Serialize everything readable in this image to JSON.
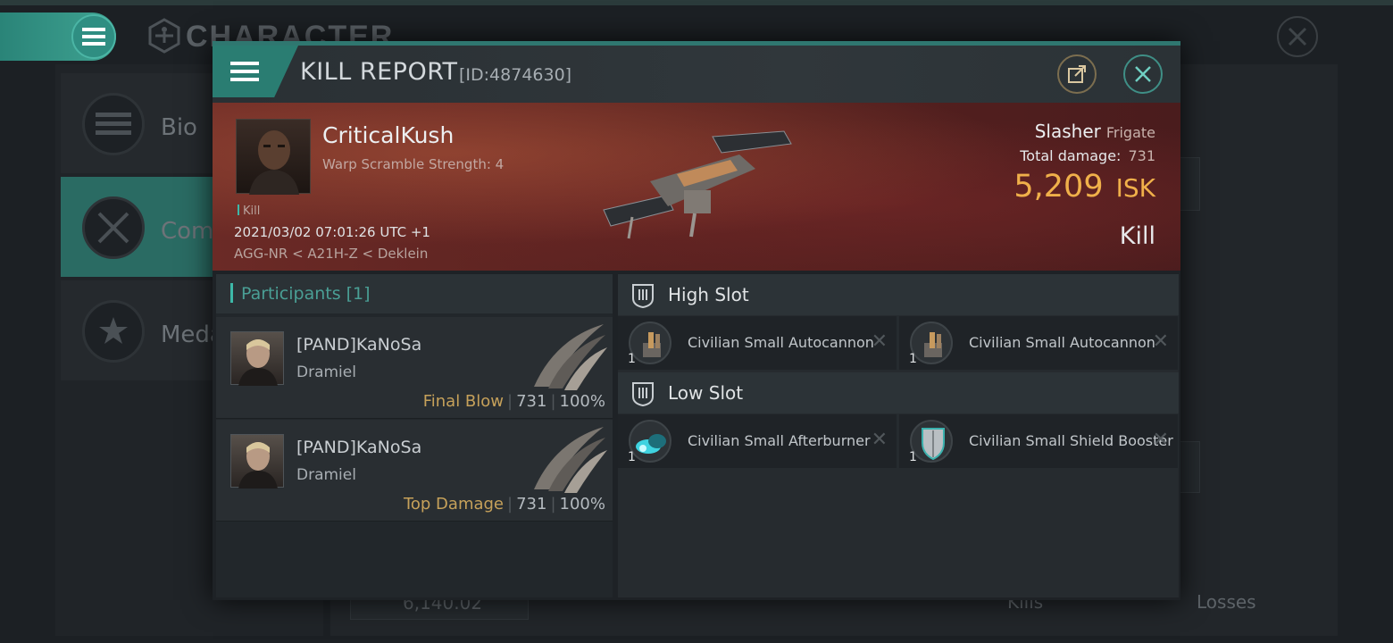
{
  "background": {
    "title": "CHARACTER",
    "sidebar": [
      {
        "label": "Bio",
        "icon": "menu-lines-icon"
      },
      {
        "label": "Comb",
        "icon": "crossed-swords-icon"
      },
      {
        "label": "Meda",
        "icon": "medal-star-icon"
      }
    ],
    "snippets": {
      "value": "6,140.02",
      "kills": "Kills",
      "losses": "Losses"
    }
  },
  "report": {
    "title": "KILL REPORT",
    "id": "[ID:4874630]",
    "victim": {
      "name": "CriticalKush",
      "warp": "Warp Scramble Strength: 4",
      "tag": "Kill",
      "datetime": "2021/03/02 07:01:26 UTC +1",
      "location": "AGG-NR < A21H-Z < Deklein"
    },
    "ship": {
      "name": "Slasher",
      "class": "Frigate",
      "damage_label": "Total damage:",
      "damage": "731",
      "isk_value": "5,209",
      "isk_unit": "ISK",
      "result": "Kill"
    },
    "participants_label": "Participants [1]",
    "participants": [
      {
        "name": "[PAND]KaNoSa",
        "ship": "Dramiel",
        "role": "Final Blow",
        "damage": "731",
        "percent": "100%"
      },
      {
        "name": "[PAND]KaNoSa",
        "ship": "Dramiel",
        "role": "Top Damage",
        "damage": "731",
        "percent": "100%"
      }
    ],
    "slots": [
      {
        "label": "High Slot",
        "modules": [
          {
            "name": "Civilian Small Autocannon",
            "qty": "1",
            "icon": "autocannon-icon"
          },
          {
            "name": "Civilian Small Autocannon",
            "qty": "1",
            "icon": "autocannon-icon"
          }
        ]
      },
      {
        "label": "Low Slot",
        "modules": [
          {
            "name": "Civilian Small Afterburner",
            "qty": "1",
            "icon": "afterburner-icon"
          },
          {
            "name": "Civilian Small Shield Booster",
            "qty": "1",
            "icon": "shield-booster-icon"
          }
        ]
      }
    ]
  },
  "colors": {
    "accent": "#2a7d72",
    "isk": "#f0b04a",
    "role": "#c6a15a"
  }
}
